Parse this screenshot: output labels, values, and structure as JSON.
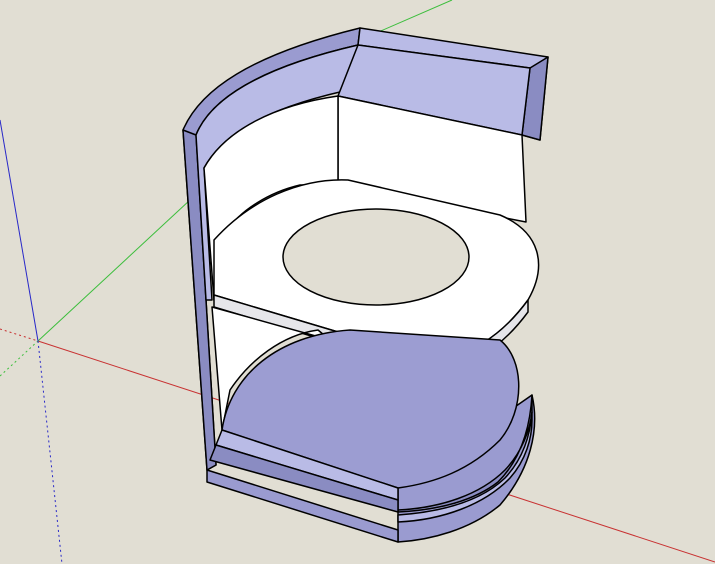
{
  "viewport": {
    "background_color": "#e1ded3",
    "view": "perspective",
    "drawing_axes": [
      {
        "axis": "red",
        "color": "#c83232"
      },
      {
        "axis": "green",
        "color": "#3cbe3c"
      },
      {
        "axis": "blue",
        "color": "#2828c8"
      }
    ]
  },
  "model": {
    "faces": {
      "wall_outer_color": "#9a9bd0",
      "wall_inner_color": "#b9bbe6",
      "wall_shadow_color": "#8a8cc2",
      "floor_color": "#9c9dd2",
      "panel_color": "#ffffff",
      "panel_shade_color": "#e6e6ea",
      "edge_color": "#000000"
    },
    "components": [
      {
        "name": "curved-outer-wall"
      },
      {
        "name": "back-wall-panel"
      },
      {
        "name": "round-shelf-with-hole"
      },
      {
        "name": "floor-disc"
      },
      {
        "name": "base-ring"
      }
    ]
  }
}
